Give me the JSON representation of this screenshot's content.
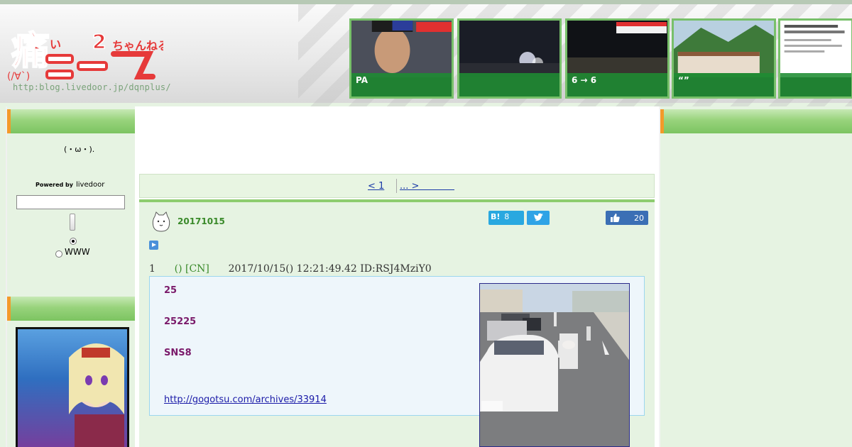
{
  "header": {
    "logo_url": "http:blog.livedoor.jp/dqnplus/"
  },
  "thumbnails": [
    {
      "caption": "PA"
    },
    {
      "caption": ""
    },
    {
      "caption": "6 → 6"
    },
    {
      "caption": "“”"
    },
    {
      "caption": ""
    }
  ],
  "sidebar": {
    "face": "(・ω・).",
    "powered_by": "Powered by",
    "livedoor": "livedoor",
    "radio_www": "WWW"
  },
  "pager": {
    "prev": "< 1",
    "next": "... >            "
  },
  "article": {
    "date": "20171015",
    "hatena_count": "8",
    "like_count": "20",
    "post": {
      "number": "1",
      "name": "() [CN]",
      "meta": "2017/10/15() 12:21:49.42 ID:RSJ4MziY0",
      "lines": [
        "25",
        "25225",
        "SNS8"
      ],
      "link": "http://gogotsu.com/archives/33914"
    }
  },
  "colors": {
    "accent_green": "#8dcc6f",
    "bar_orange": "#f39a2a",
    "link_blue": "#1a3aa8",
    "post_text": "#7a1a6a"
  }
}
